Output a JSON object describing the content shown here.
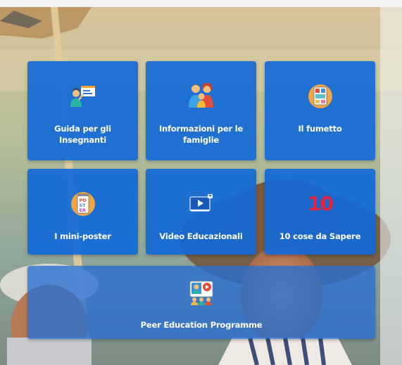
{
  "tiles": [
    {
      "label": "Guida per gli Insegnanti",
      "icon": "teacher-presentation-icon"
    },
    {
      "label": "Informazioni per le famiglie",
      "icon": "family-icon"
    },
    {
      "label": "Il fumetto",
      "icon": "comic-book-icon"
    },
    {
      "label": "I mini-poster",
      "icon": "poster-icon"
    },
    {
      "label": "Video Educazionali",
      "icon": "video-player-icon"
    },
    {
      "label": "10 cose da Sapere",
      "icon": "number-ten-icon",
      "number": "10"
    },
    {
      "label": "Peer Education Programme",
      "icon": "peer-group-video-icon"
    }
  ],
  "colors": {
    "tile": "#1269d7",
    "number_ten": "#e8223a",
    "label": "#ffffff"
  }
}
